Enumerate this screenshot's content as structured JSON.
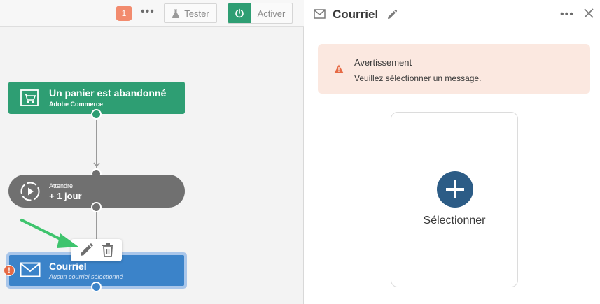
{
  "toolbar": {
    "badge_count": "1",
    "more_label": "•••",
    "tester_label": "Tester",
    "activer_label": "Activer"
  },
  "nodes": {
    "trigger": {
      "title": "Un panier est abandonné",
      "subtitle": "Adobe Commerce",
      "icon": "cart-icon"
    },
    "wait": {
      "subtitle": "Attendre",
      "title": "+ 1 jour",
      "icon": "play-circle-icon"
    },
    "email": {
      "title": "Courriel",
      "subtitle": "Aucun courriel sélectionné",
      "icon": "mail-icon",
      "error_badge": "!"
    }
  },
  "node_actions": {
    "edit_icon": "pencil-icon",
    "delete_icon": "trash-icon"
  },
  "panel": {
    "title": "Courriel",
    "more_label": "•••",
    "alert": {
      "title": "Avertissement",
      "message": "Veuillez sélectionner un message."
    },
    "select_label": "Sélectionner"
  },
  "colors": {
    "trigger": "#2e9e73",
    "wait": "#707070",
    "email": "#3b83c9",
    "alert_bg": "#fbe8e0",
    "warning": "#e66a45",
    "plus_button": "#2c5c86",
    "arrow": "#3ec46d"
  }
}
